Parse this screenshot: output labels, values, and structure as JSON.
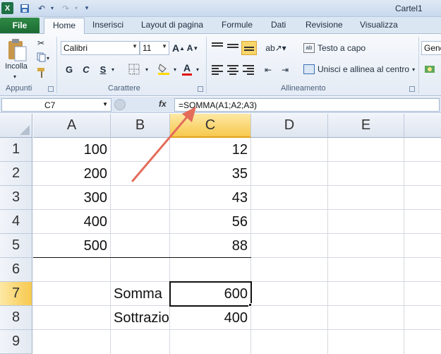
{
  "title_bar": {
    "app_logo": "X",
    "title": "Cartel1",
    "icons": [
      "excel-logo-icon",
      "save-icon",
      "undo-icon",
      "redo-icon",
      "customize-qat-icon"
    ]
  },
  "tabs": {
    "file": "File",
    "items": [
      "Home",
      "Inserisci",
      "Layout di pagina",
      "Formule",
      "Dati",
      "Revisione",
      "Visualizza"
    ],
    "active": "Home"
  },
  "ribbon": {
    "clipboard": {
      "paste_label": "Incolla",
      "group_label": "Appunti"
    },
    "font": {
      "font_name": "Calibri",
      "font_size": "11",
      "bold": "G",
      "italic": "C",
      "underline": "S",
      "grow_label": "A",
      "shrink_label": "A",
      "color_label": "A",
      "group_label": "Carattere"
    },
    "alignment": {
      "wrap_text": "Testo a capo",
      "merge_center": "Unisci e allinea al centro",
      "group_label": "Allineamento"
    },
    "number": {
      "format": "Gene"
    },
    "accent_color": "#1e7145"
  },
  "formula_bar": {
    "name_box": "C7",
    "fx": "fx",
    "formula": "=SOMMA(A1;A2;A3)"
  },
  "grid": {
    "columns": [
      "A",
      "B",
      "C",
      "D",
      "E"
    ],
    "rows": [
      "1",
      "2",
      "3",
      "4",
      "5",
      "6",
      "7",
      "8",
      "9"
    ],
    "selected_column": "C",
    "selected_row": "7",
    "cells": {
      "A1": "100",
      "A2": "200",
      "A3": "300",
      "A4": "400",
      "A5": "500",
      "C1": "12",
      "C2": "35",
      "C3": "43",
      "C4": "56",
      "C5": "88",
      "B7": "Somma",
      "C7": "600",
      "B8": "Sottrazione",
      "C8": "400"
    },
    "annotation_arrow_color": "#e36c5a"
  }
}
